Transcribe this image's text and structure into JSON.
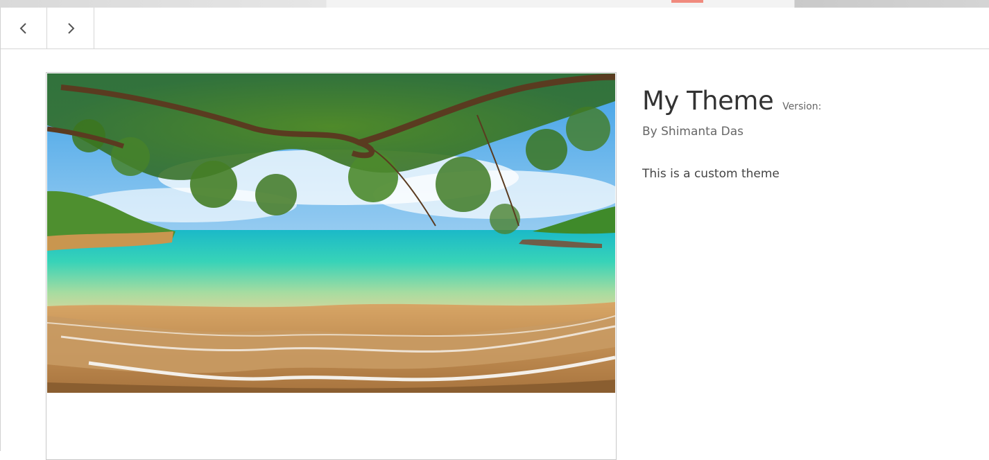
{
  "toolbar": {
    "prev_icon": "chevron-left-icon",
    "next_icon": "chevron-right-icon"
  },
  "theme": {
    "title": "My Theme",
    "version_label": "Version:",
    "author": "By Shimanta Das",
    "description": "This is a custom theme"
  },
  "colors": {
    "title_text": "#333333",
    "secondary_text": "#666666",
    "border": "#d6d6d6"
  }
}
